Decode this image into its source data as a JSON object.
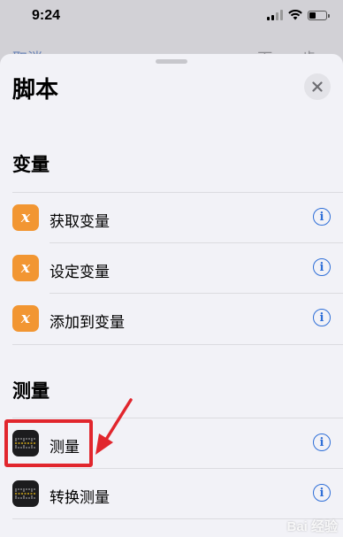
{
  "status_bar": {
    "time": "9:24"
  },
  "behind": {
    "cancel_label": "取消",
    "right_label": "下 步"
  },
  "sheet": {
    "title": "脚本",
    "close_icon": "close-icon"
  },
  "sections": {
    "variables": {
      "header": "变量",
      "items": [
        {
          "label": "获取变量",
          "icon": "variable-icon"
        },
        {
          "label": "设定变量",
          "icon": "variable-icon"
        },
        {
          "label": "添加到变量",
          "icon": "variable-icon"
        }
      ]
    },
    "measurement": {
      "header": "测量",
      "items": [
        {
          "label": "测量",
          "icon": "measure-icon"
        },
        {
          "label": "转换测量",
          "icon": "measure-icon"
        }
      ]
    }
  },
  "info_glyph": "i",
  "variable_glyph": "x",
  "colors": {
    "variable_icon": "#f29632",
    "measure_icon": "#1c1c1e",
    "info_blue": "#2f6fd8",
    "annotation_red": "#e1262d"
  },
  "watermark": "Bai 经验"
}
